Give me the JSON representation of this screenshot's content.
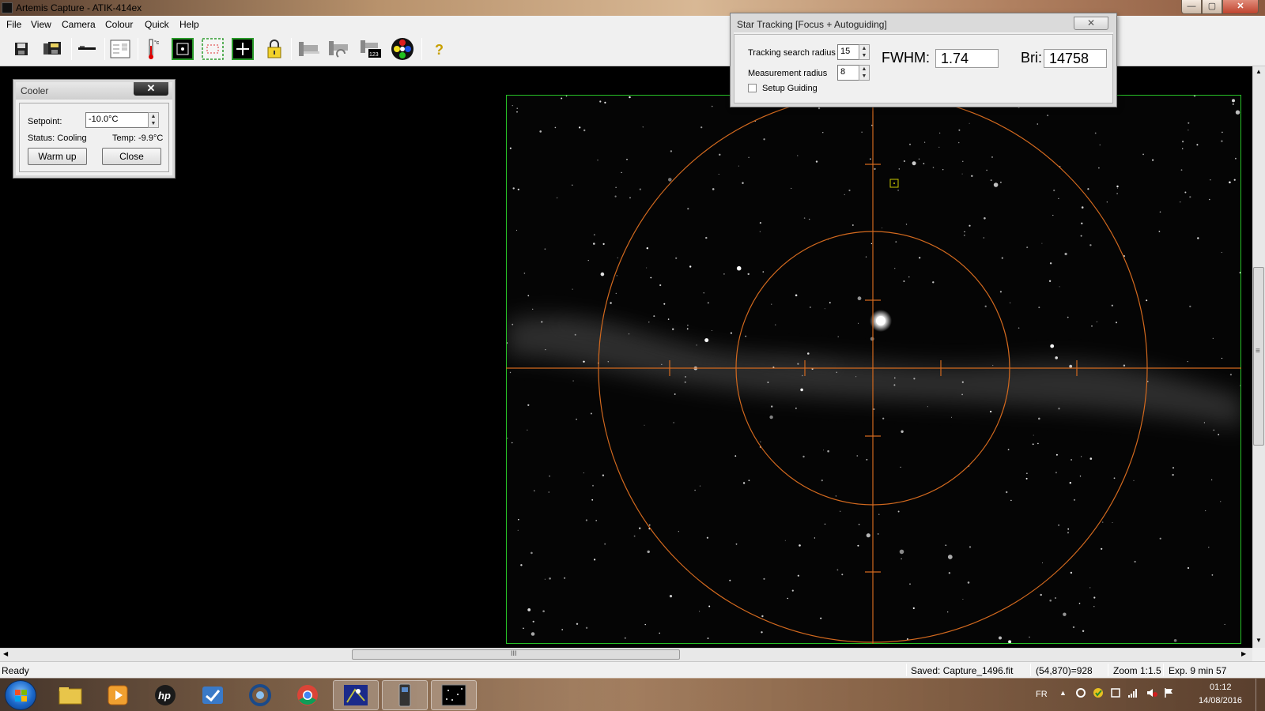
{
  "window": {
    "title": "Artemis Capture - ATIK-414ex"
  },
  "menu": [
    "File",
    "View",
    "Camera",
    "Colour",
    "Quick",
    "Help"
  ],
  "toolbar_icons": [
    "save-icon",
    "save-sequence-icon",
    "telescope-icon",
    "settings-panel-icon",
    "thermometer-icon",
    "focus-target-icon",
    "subframe-icon",
    "crosshair-icon",
    "lock-icon",
    "flat-capture-icon",
    "dark-capture-icon",
    "batch-capture-icon",
    "colour-wheel-icon",
    "help-icon"
  ],
  "cooler": {
    "title": "Cooler",
    "close_glyph": "✕",
    "setpoint_label": "Setpoint:",
    "setpoint_value": "-10.0°C",
    "status_text": "Status: Cooling",
    "temp_text": "Temp: -9.9°C",
    "warm_up_label": "Warm up",
    "close_label": "Close"
  },
  "tracking": {
    "title": "Star Tracking [Focus + Autoguiding]",
    "close_glyph": "✕",
    "search_radius_label": "Tracking search radius",
    "search_radius_value": "15",
    "measurement_radius_label": "Measurement radius",
    "measurement_radius_value": "8",
    "setup_guiding_label": "Setup Guiding",
    "setup_guiding_checked": false,
    "fwhm_label": "FWHM:",
    "fwhm_value": "1.74",
    "bri_label": "Bri:",
    "bri_value": "14758"
  },
  "scroll": {
    "h_grip": "III",
    "v_grip": "≡"
  },
  "status": {
    "left": "Ready",
    "saved": "Saved: Capture_1496.fit",
    "pixel": "(54,870)=928",
    "zoom": "Zoom 1:1.5",
    "exposure": "Exp. 9 min 57"
  },
  "taskbar": {
    "apps": [
      "file-explorer-icon",
      "media-player-icon",
      "hp-icon",
      "task-app-icon",
      "photo-app-icon",
      "chrome-icon",
      "artemis-capture-icon",
      "device-app-icon",
      "star-image-icon"
    ],
    "lang": "FR",
    "time": "01:12",
    "date": "14/08/2016"
  },
  "colors": {
    "overlay": "#d2691e",
    "frame": "#26c026",
    "selection": "#c8c800"
  }
}
